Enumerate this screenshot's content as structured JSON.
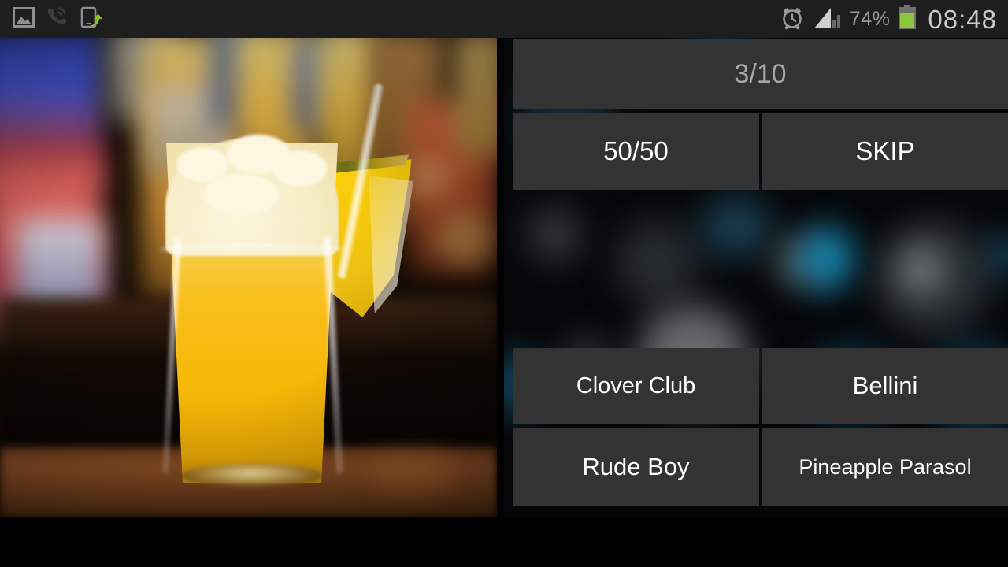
{
  "status_bar": {
    "left_icons": [
      {
        "name": "image-icon",
        "label": "Screenshot captured"
      },
      {
        "name": "missed-call-icon",
        "label": "Missed call"
      },
      {
        "name": "smart-share-icon",
        "label": "Share shot"
      }
    ],
    "right": {
      "alarm_icon": "alarm-clock-icon",
      "signal_icon": "signal-bars-icon",
      "battery_percent": "74%",
      "battery_icon": "battery-icon",
      "clock": "08:48"
    },
    "colors": {
      "background": "#1e1e1e",
      "battery_fill": "#8cc63e",
      "text": "#c9c9c9"
    }
  },
  "quiz": {
    "progress_label": "3/10",
    "helpers": [
      {
        "name": "fifty-fifty",
        "label": "50/50"
      },
      {
        "name": "skip",
        "label": "SKIP"
      }
    ],
    "image_alt": "Yellow tropical cocktail in a glass with crushed ice, straw and pineapple wedge on a bar counter",
    "answers": [
      {
        "name": "answer-clover-club",
        "label": "Clover Club"
      },
      {
        "name": "answer-bellini",
        "label": "Bellini"
      },
      {
        "name": "answer-rude-boy",
        "label": "Rude Boy"
      },
      {
        "name": "answer-pineapple-parasol",
        "label": "Pineapple Parasol"
      }
    ],
    "colors": {
      "card_background": "#333333",
      "card_text": "#ffffff",
      "progress_text": "#a8a8a8",
      "panel_background": "#050608"
    }
  }
}
